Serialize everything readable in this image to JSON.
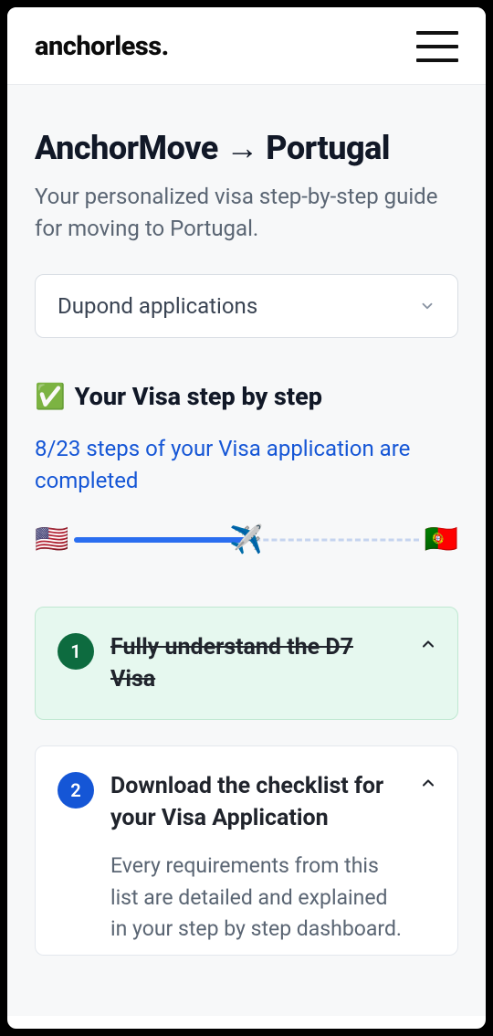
{
  "header": {
    "logo": "anchorless."
  },
  "page": {
    "title": "AnchorMove → Portugal",
    "subtitle": "Your personalized visa step-by-step guide for moving to Portugal."
  },
  "select": {
    "value": "Dupond applications"
  },
  "steps": {
    "heading": "Your Visa step by step",
    "progress_text": "8/23 steps of your Visa application are completed",
    "completed": 8,
    "total": 23,
    "flag_from": "🇺🇸",
    "flag_to": "🇵🇹",
    "plane": "✈️"
  },
  "cards": [
    {
      "num": "1",
      "title": "Fully understand the D7 Visa",
      "done": true
    },
    {
      "num": "2",
      "title": "Download the checklist for your Visa Application",
      "done": false,
      "desc": "Every requirements from this list are detailed and explained in your step by step dashboard."
    }
  ]
}
